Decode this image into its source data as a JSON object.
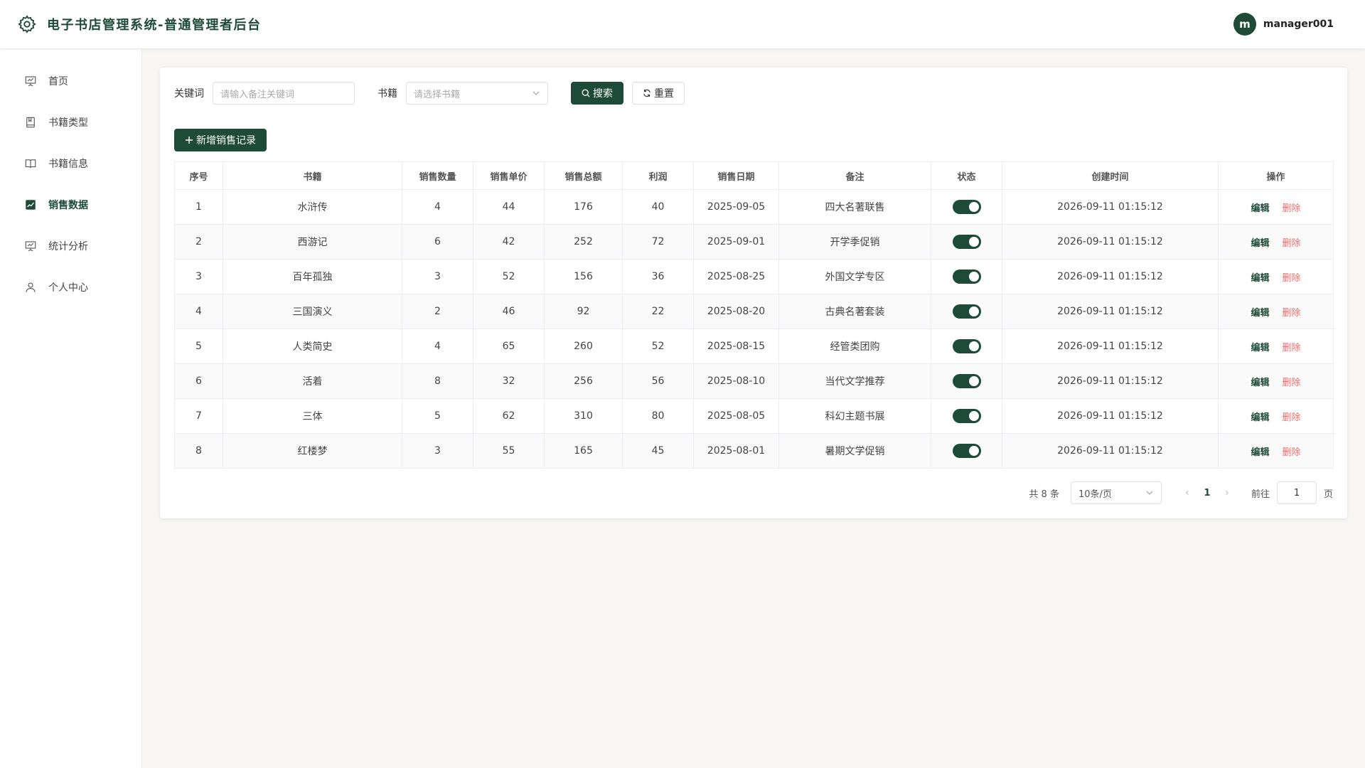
{
  "header": {
    "title": "电子书店管理系统-普通管理者后台",
    "avatar_letter": "m",
    "username": "manager001",
    "accent_color": "#1e4a38"
  },
  "sidebar": {
    "items": [
      {
        "label": "首页",
        "icon": "presentation-icon",
        "active": false
      },
      {
        "label": "书籍类型",
        "icon": "book-icon",
        "active": false
      },
      {
        "label": "书籍信息",
        "icon": "open-book-icon",
        "active": false
      },
      {
        "label": "销售数据",
        "icon": "chart-icon",
        "active": true
      },
      {
        "label": "统计分析",
        "icon": "presentation-icon",
        "active": false
      },
      {
        "label": "个人中心",
        "icon": "user-icon",
        "active": false
      }
    ]
  },
  "filters": {
    "keyword_label": "关键词",
    "keyword_placeholder": "请输入备注关键词",
    "book_label": "书籍",
    "book_placeholder": "请选择书籍",
    "search_label": "搜索",
    "reset_label": "重置"
  },
  "add_button_label": "新增销售记录",
  "table": {
    "headers": [
      "序号",
      "书籍",
      "销售数量",
      "销售单价",
      "销售总额",
      "利润",
      "销售日期",
      "备注",
      "状态",
      "创建时间",
      "操作"
    ],
    "rows": [
      {
        "no": "1",
        "book": "水浒传",
        "qty": "4",
        "price": "44",
        "total": "176",
        "profit": "40",
        "date": "2025-09-05",
        "note": "四大名著联售",
        "status": true,
        "created": "2026-09-11 01:15:12"
      },
      {
        "no": "2",
        "book": "西游记",
        "qty": "6",
        "price": "42",
        "total": "252",
        "profit": "72",
        "date": "2025-09-01",
        "note": "开学季促销",
        "status": true,
        "created": "2026-09-11 01:15:12"
      },
      {
        "no": "3",
        "book": "百年孤独",
        "qty": "3",
        "price": "52",
        "total": "156",
        "profit": "36",
        "date": "2025-08-25",
        "note": "外国文学专区",
        "status": true,
        "created": "2026-09-11 01:15:12"
      },
      {
        "no": "4",
        "book": "三国演义",
        "qty": "2",
        "price": "46",
        "total": "92",
        "profit": "22",
        "date": "2025-08-20",
        "note": "古典名著套装",
        "status": true,
        "created": "2026-09-11 01:15:12"
      },
      {
        "no": "5",
        "book": "人类简史",
        "qty": "4",
        "price": "65",
        "total": "260",
        "profit": "52",
        "date": "2025-08-15",
        "note": "经管类团购",
        "status": true,
        "created": "2026-09-11 01:15:12"
      },
      {
        "no": "6",
        "book": "活着",
        "qty": "8",
        "price": "32",
        "total": "256",
        "profit": "56",
        "date": "2025-08-10",
        "note": "当代文学推荐",
        "status": true,
        "created": "2026-09-11 01:15:12"
      },
      {
        "no": "7",
        "book": "三体",
        "qty": "5",
        "price": "62",
        "total": "310",
        "profit": "80",
        "date": "2025-08-05",
        "note": "科幻主题书展",
        "status": true,
        "created": "2026-09-11 01:15:12"
      },
      {
        "no": "8",
        "book": "红楼梦",
        "qty": "3",
        "price": "55",
        "total": "165",
        "profit": "45",
        "date": "2025-08-01",
        "note": "暑期文学促销",
        "status": true,
        "created": "2026-09-11 01:15:12"
      }
    ],
    "edit_label": "编辑",
    "delete_label": "删除"
  },
  "pagination": {
    "total_text": "共 8 条",
    "page_size": "10条/页",
    "current_page": "1",
    "goto_label": "前往",
    "goto_value": "1",
    "page_suffix": "页"
  }
}
